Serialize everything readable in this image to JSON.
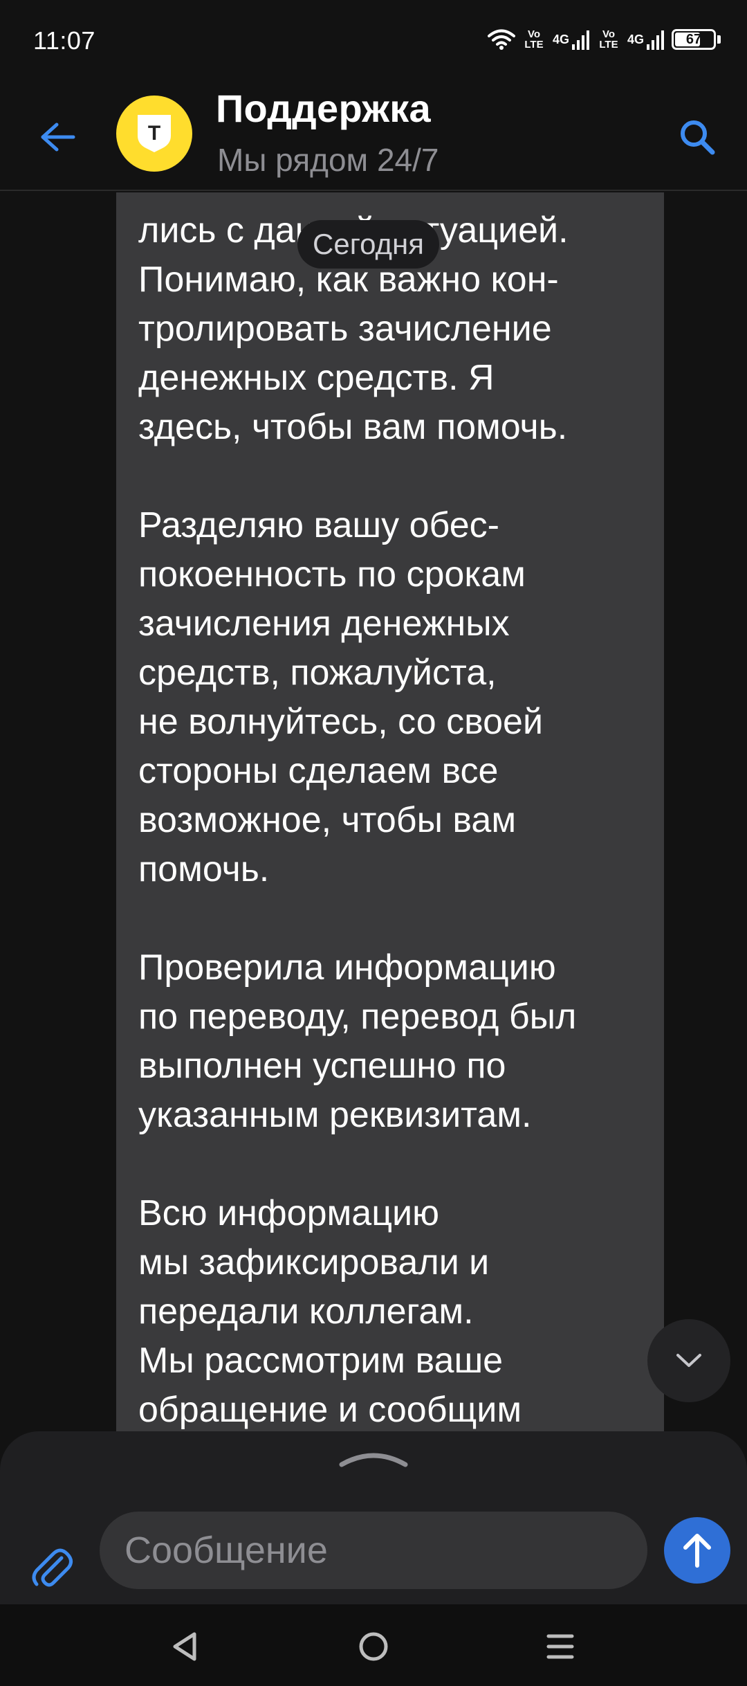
{
  "status_bar": {
    "time": "11:07",
    "sim1_label_top": "Vo",
    "sim1_label_bottom": "LTE",
    "sim1_network": "4G",
    "sim2_label_top": "Vo",
    "sim2_label_bottom": "LTE",
    "sim2_network": "4G",
    "battery_level": "67",
    "battery_fraction": 0.67
  },
  "header": {
    "title": "Поддержка",
    "subtitle": "Мы рядом 24/7",
    "avatar_letter": "Т"
  },
  "chat": {
    "date_label": "Сегодня",
    "message_paragraphs": [
      "лись с данной ситуацией.\nПонимаю, как важно кон-\nтролировать зачисление\nденежных средств. Я\nздесь, чтобы вам помочь.",
      "Разделяю вашу обес-\nпокоенность по срокам\nзачисления денежных\nсредств, пожалуйста,\nне волнуйтесь, со своей\nстороны сделаем все\nвозможное, чтобы вам\nпомочь.",
      "Проверила информацию\nпо переводу, перевод был\nвыполнен успешно по\nуказанным реквизитам.",
      "Всю информацию\nмы зафиксировали и\nпередали коллегам.\nМы рассмотрим ваше\nобращение и сообщим"
    ]
  },
  "composer": {
    "placeholder": "Сообщение"
  },
  "icons": {
    "back": "arrow-left-icon",
    "search": "search-icon",
    "scroll_down": "chevron-down-icon",
    "attach": "paperclip-icon",
    "send": "arrow-up-icon",
    "nav_back": "triangle-back-icon",
    "nav_home": "circle-home-icon",
    "nav_recents": "menu-lines-icon"
  },
  "colors": {
    "accent": "#3d8bf0",
    "brand_yellow": "#ffdd2d",
    "bubble": "#3a3a3c",
    "background": "#121212"
  }
}
